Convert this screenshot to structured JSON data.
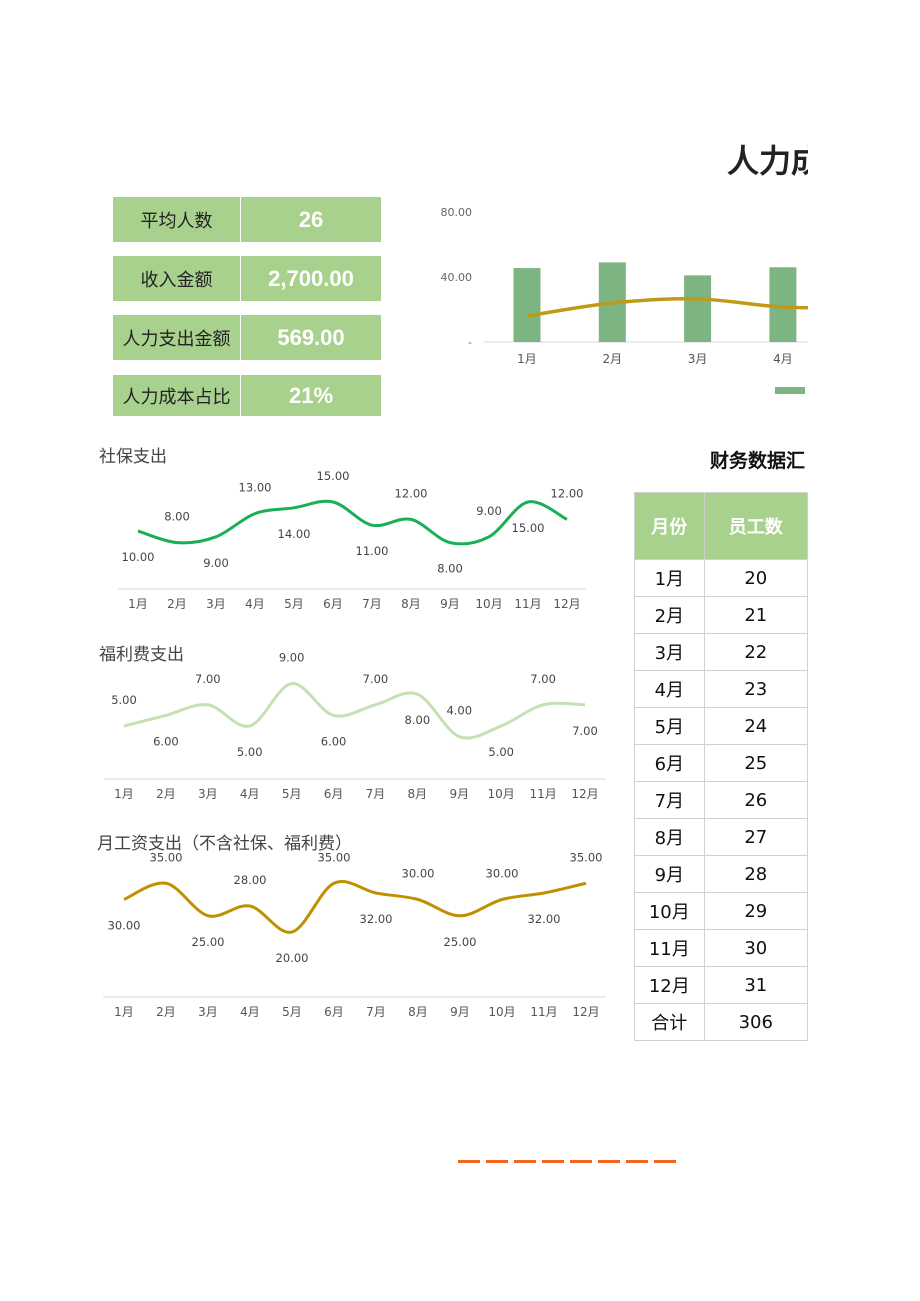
{
  "header": {
    "title": "人力成"
  },
  "kpis": [
    {
      "label": "平均人数",
      "value": "26"
    },
    {
      "label": "收入金额",
      "value": "2,700.00"
    },
    {
      "label": "人力支出金额",
      "value": "569.00"
    },
    {
      "label": "人力成本占比",
      "value": "21%"
    }
  ],
  "colors": {
    "kpi_bg": "#a9d18e",
    "bar": "#7db582",
    "line_gold": "#c09a17",
    "social": "#1aaf54",
    "welfare": "#c5e0b4",
    "salary": "#bf9000",
    "footer_text": "#f26522"
  },
  "chart_data": [
    {
      "type": "bar+line",
      "categories": [
        "1月",
        "2月",
        "3月",
        "4月"
      ],
      "ytick_labels": [
        "80.00",
        "40.00",
        "-"
      ],
      "ylim": [
        0,
        80
      ],
      "series": [
        {
          "type": "bar",
          "values": [
            45.5,
            49,
            41,
            46
          ]
        },
        {
          "type": "line",
          "values": [
            16,
            24,
            26.5,
            21.5
          ]
        }
      ],
      "grid": false
    },
    {
      "type": "line",
      "title": "社保支出",
      "categories": [
        "1月",
        "2月",
        "3月",
        "4月",
        "5月",
        "6月",
        "7月",
        "8月",
        "9月",
        "10月",
        "11月",
        "12月"
      ],
      "values": [
        10,
        8,
        9,
        13,
        14,
        15,
        11,
        12,
        8,
        9,
        15,
        12
      ],
      "labels": [
        "10.00",
        "8.00",
        "9.00",
        "13.00",
        "14.00",
        "15.00",
        "11.00",
        "12.00",
        "8.00",
        "9.00",
        "15.00",
        "12.00"
      ]
    },
    {
      "type": "line",
      "title": "福利费支出",
      "categories": [
        "1月",
        "2月",
        "3月",
        "4月",
        "5月",
        "6月",
        "7月",
        "8月",
        "9月",
        "10月",
        "11月",
        "12月"
      ],
      "values": [
        5,
        6,
        7,
        5,
        9,
        6,
        7,
        8,
        4,
        5,
        7,
        7
      ],
      "labels": [
        "5.00",
        "6.00",
        "7.00",
        "5.00",
        "9.00",
        "6.00",
        "7.00",
        "8.00",
        "4.00",
        "5.00",
        "7.00",
        "7.00"
      ]
    },
    {
      "type": "line",
      "title": "月工资支出（不含社保、福利费）",
      "categories": [
        "1月",
        "2月",
        "3月",
        "4月",
        "5月",
        "6月",
        "7月",
        "8月",
        "9月",
        "10月",
        "11月",
        "12月"
      ],
      "values": [
        30,
        35,
        25,
        28,
        20,
        35,
        32,
        30,
        25,
        30,
        32,
        35
      ],
      "labels": [
        "30.00",
        "35.00",
        "25.00",
        "28.00",
        "20.00",
        "35.00",
        "32.00",
        "30.00",
        "25.00",
        "30.00",
        "32.00",
        "35.00"
      ]
    }
  ],
  "table": {
    "title": "财务数据汇",
    "headers": [
      "月份",
      "员工数"
    ],
    "rows": [
      [
        "1月",
        "20"
      ],
      [
        "2月",
        "21"
      ],
      [
        "3月",
        "22"
      ],
      [
        "4月",
        "23"
      ],
      [
        "5月",
        "24"
      ],
      [
        "6月",
        "25"
      ],
      [
        "7月",
        "26"
      ],
      [
        "8月",
        "27"
      ],
      [
        "9月",
        "28"
      ],
      [
        "10月",
        "29"
      ],
      [
        "11月",
        "30"
      ],
      [
        "12月",
        "31"
      ],
      [
        "合计",
        "306"
      ]
    ]
  }
}
